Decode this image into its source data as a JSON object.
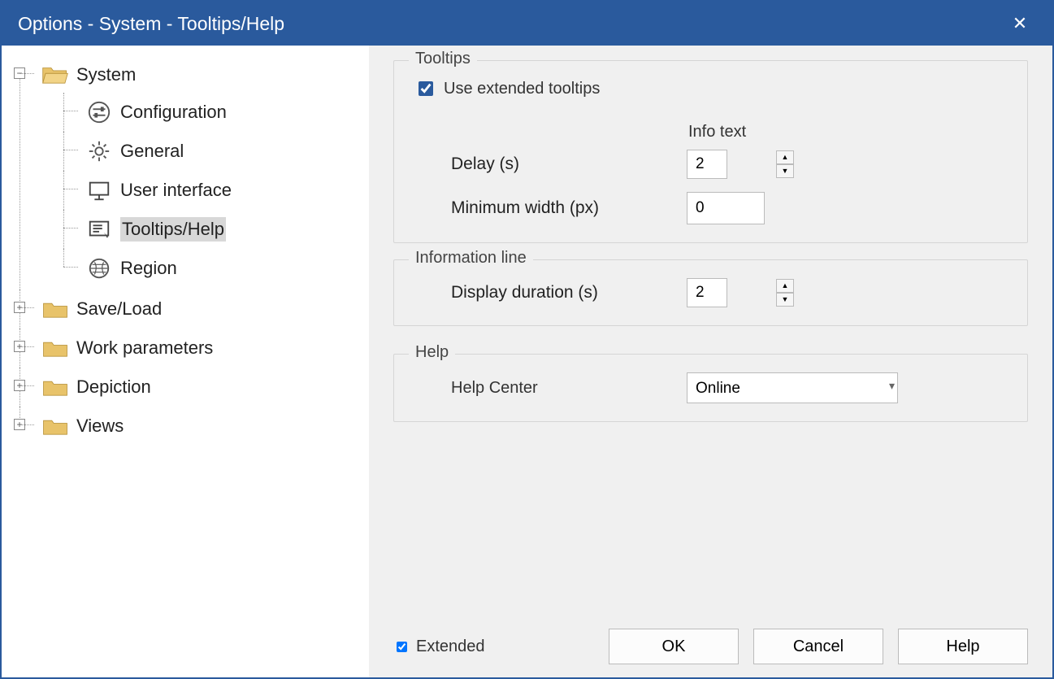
{
  "window": {
    "title": "Options - System - Tooltips/Help"
  },
  "tree": {
    "system": {
      "label": "System",
      "children": {
        "configuration": "Configuration",
        "general": "General",
        "user_interface": "User interface",
        "tooltips_help": "Tooltips/Help",
        "region": "Region"
      }
    },
    "save_load": "Save/Load",
    "work_parameters": "Work parameters",
    "depiction": "Depiction",
    "views": "Views"
  },
  "panel": {
    "tooltips": {
      "legend": "Tooltips",
      "use_extended": "Use extended tooltips",
      "info_text_header": "Info text",
      "delay_label": "Delay (s)",
      "delay_value": "2",
      "min_width_label": "Minimum width (px)",
      "min_width_value": "0"
    },
    "info_line": {
      "legend": "Information line",
      "duration_label": "Display duration (s)",
      "duration_value": "2"
    },
    "help": {
      "legend": "Help",
      "center_label": "Help Center",
      "center_value": "Online"
    }
  },
  "footer": {
    "extended": "Extended",
    "ok": "OK",
    "cancel": "Cancel",
    "help": "Help"
  }
}
